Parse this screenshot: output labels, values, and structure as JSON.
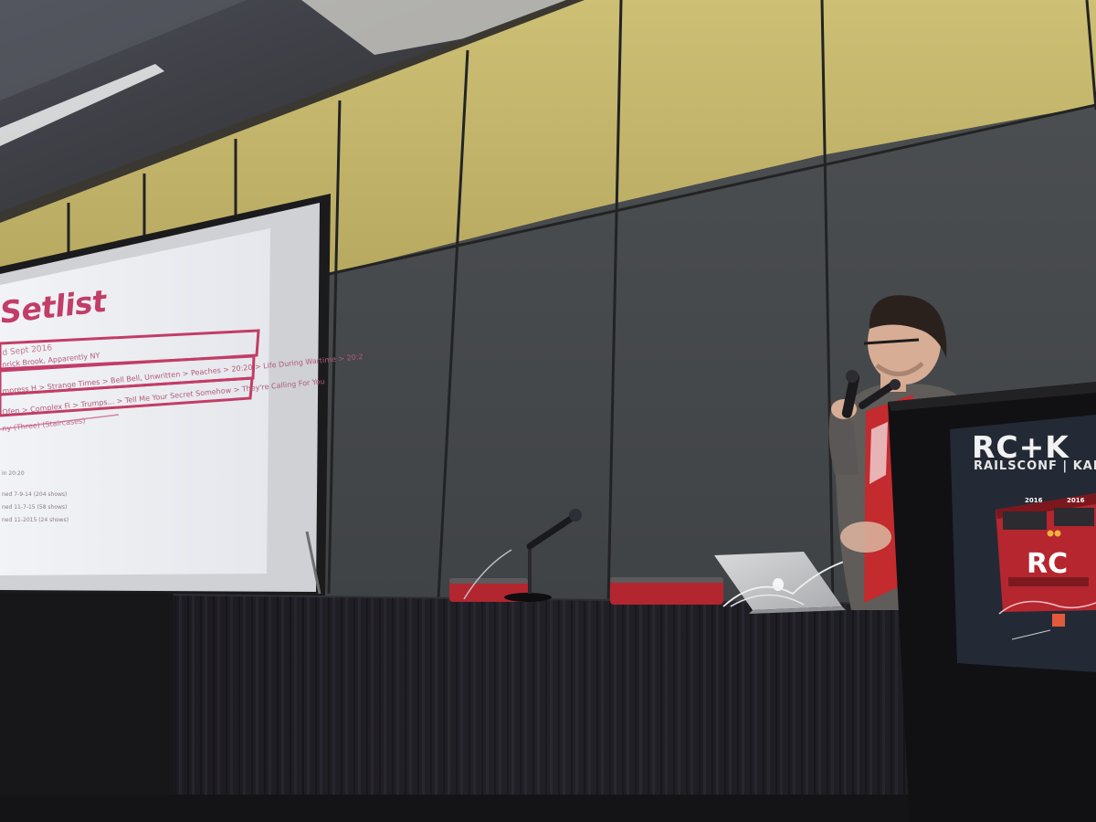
{
  "slide": {
    "title": "Setlist",
    "subtitle": "d Sept 2016",
    "line1": "nrick Brook, Apparently NY",
    "line2": "mpress H > Strange Times > Bell Bell, Unwritten > Peaches > 20:20 > Life During Wartime > 20:2",
    "line3": "Ofen > Complex Fi > Trumps... > Tell Me Your Secret Somehow > They're Calling For You",
    "line4": "ny (Three) (Staircases)",
    "small1": "in 20:20",
    "small2": "ned 7-9-14 (204 shows)",
    "small3": "ned 11-7-15 (58 shows)",
    "small4": "ned 11-2015 (24 shows)"
  },
  "podium_sign": {
    "brand": "RC+K",
    "tagline": "RAILSCONF | KANSAS",
    "train_year_left": "2016",
    "train_year_right": "2016",
    "train_logo": "RC"
  },
  "colors": {
    "wall_yellow": "#c2b46c",
    "wall_gray": "#45484a",
    "slide_accent": "#c23d67",
    "table_skirt": "#1d1c22",
    "sign_bg": "#242b36",
    "train_red": "#b5262f"
  }
}
